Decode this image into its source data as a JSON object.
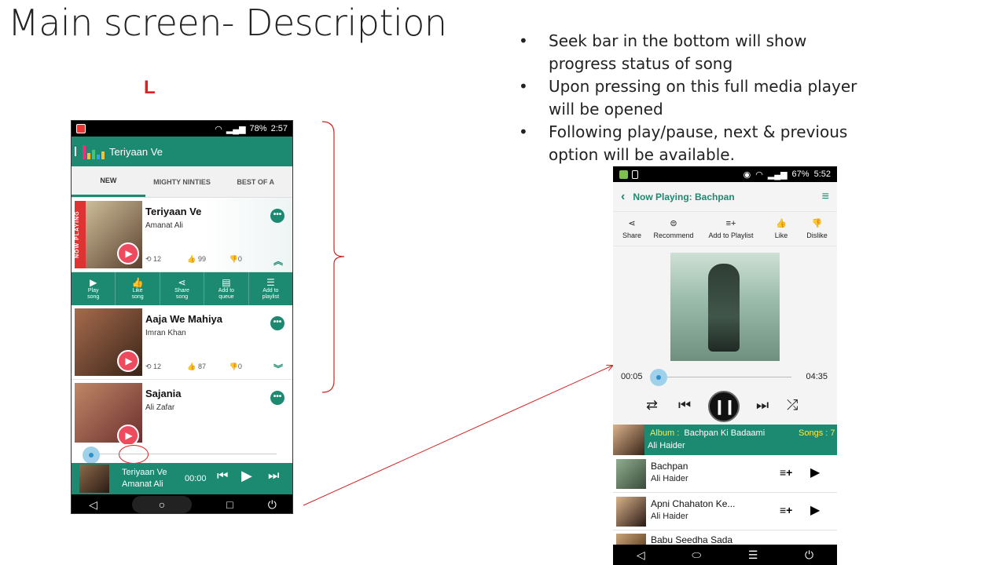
{
  "slide": {
    "title": "Main screen- Description",
    "marker_letter": "L",
    "bullets": [
      "Seek bar in the bottom will show progress status of song",
      "Upon pressing on this full media player will be opened",
      "Following play/pause, next & previous option will be available."
    ]
  },
  "phone1": {
    "status": {
      "battery": "78%",
      "time": "2:57"
    },
    "app_title": "Teriyaan Ve",
    "tabs": [
      "NEW",
      "MIGHTY NINTIES",
      "BEST OF A"
    ],
    "now_playing_tag": "NOW PLAYING",
    "songs": [
      {
        "title": "Teriyaan Ve",
        "artist": "Amanat Ali",
        "plays": "12",
        "likes": "99",
        "dislikes": "0"
      },
      {
        "title": "Aaja We Mahiya",
        "artist": "Imran Khan",
        "plays": "12",
        "likes": "87",
        "dislikes": "0"
      },
      {
        "title": "Sajania",
        "artist": "Ali Zafar"
      }
    ],
    "actions": [
      {
        "label1": "Play",
        "label2": "song"
      },
      {
        "label1": "Like",
        "label2": "song"
      },
      {
        "label1": "Share",
        "label2": "song"
      },
      {
        "label1": "Add to",
        "label2": "queue"
      },
      {
        "label1": "Add to",
        "label2": "playlist"
      }
    ],
    "mini_player": {
      "title": "Teriyaan Ve",
      "artist": "Amanat Ali",
      "time": "00:00"
    },
    "progress": 0.0
  },
  "phone2": {
    "status": {
      "battery": "67%",
      "time": "5:52"
    },
    "header": "Now Playing: Bachpan",
    "actions": [
      "Share",
      "Recommend",
      "Add to Playlist",
      "Like",
      "Dislike"
    ],
    "elapsed": "00:05",
    "duration": "04:35",
    "album_label": "Album :",
    "album_name": "Bachpan Ki Badaami",
    "songs_label": "Songs :",
    "songs_count": "7",
    "album_artist": "Ali Haider",
    "tracks": [
      {
        "name": "Bachpan",
        "artist": "Ali Haider"
      },
      {
        "name": "Apni Chahaton Ke...",
        "artist": "Ali Haider"
      }
    ],
    "partial_track": "Babu Seedha Sada"
  },
  "colors": {
    "accent": "#1c8a70",
    "play": "#ef4b5f",
    "annotation": "#d22222",
    "label_yellow": "#ffe94a"
  }
}
